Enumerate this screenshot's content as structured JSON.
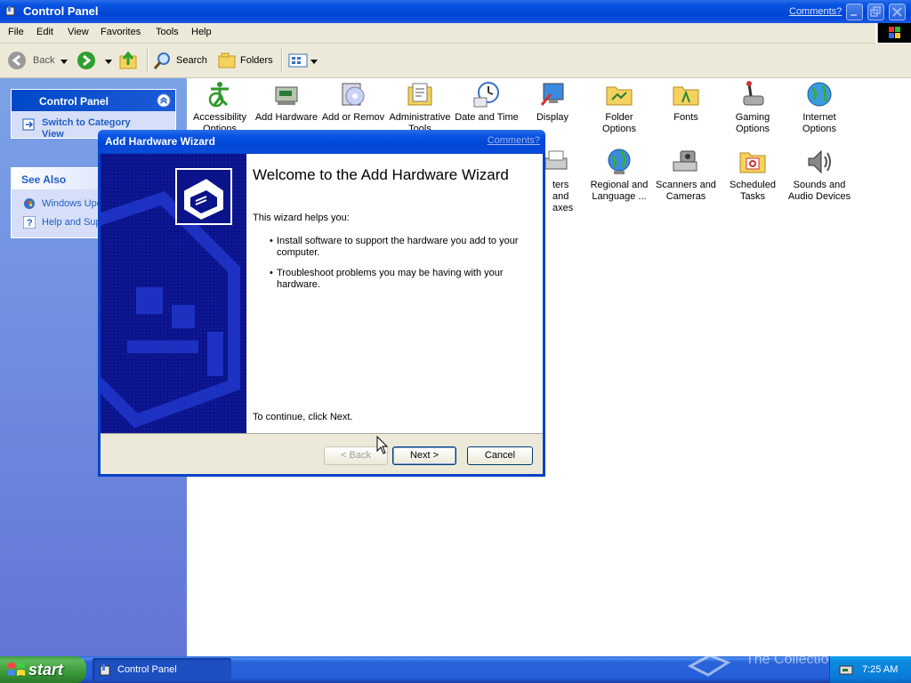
{
  "window": {
    "title": "Control Panel",
    "comments_link": "Comments?"
  },
  "menu": [
    "File",
    "Edit",
    "View",
    "Favorites",
    "Tools",
    "Help"
  ],
  "toolbar": {
    "back_label": "Back",
    "search_label": "Search",
    "folders_label": "Folders"
  },
  "left_pane": {
    "control_panel_header": "Control Panel",
    "switch_view": "Switch to Category View",
    "see_also_header": "See Also",
    "see_also_items": [
      "Windows Upd",
      "Help and Sup"
    ]
  },
  "icons_row1": [
    {
      "label": "Accessibility Options",
      "icon": "accessibility-icon"
    },
    {
      "label": "Add Hardware",
      "icon": "add-hardware-icon"
    },
    {
      "label": "Add or Remov",
      "icon": "add-remove-programs-icon"
    },
    {
      "label": "Administrative Tools",
      "icon": "administrative-tools-icon"
    },
    {
      "label": "Date and Time",
      "icon": "date-time-icon"
    },
    {
      "label": "Display",
      "icon": "display-icon"
    },
    {
      "label": "Folder Options",
      "icon": "folder-options-icon"
    },
    {
      "label": "Fonts",
      "icon": "fonts-icon"
    },
    {
      "label": "Gaming Options",
      "icon": "gaming-options-icon"
    },
    {
      "label": "Internet Options",
      "icon": "internet-options-icon"
    }
  ],
  "icons_row2": [
    {
      "label": "ters and axes",
      "icon": "printers-faxes-icon"
    },
    {
      "label": "Regional and Language ...",
      "icon": "regional-language-icon"
    },
    {
      "label": "Scanners and Cameras",
      "icon": "scanners-cameras-icon"
    },
    {
      "label": "Scheduled Tasks",
      "icon": "scheduled-tasks-icon"
    },
    {
      "label": "Sounds and Audio Devices",
      "icon": "sounds-audio-icon"
    }
  ],
  "wizard": {
    "title": "Add Hardware Wizard",
    "comments_link": "Comments?",
    "heading": "Welcome to the Add Hardware Wizard",
    "intro": "This wizard helps you:",
    "bullets": [
      "Install software to support the hardware you add to your computer.",
      "Troubleshoot problems you may be having with your hardware."
    ],
    "continue_text": "To continue, click Next.",
    "back_button": "< Back",
    "next_button": "Next >",
    "cancel_button": "Cancel"
  },
  "taskbar": {
    "start_label": "start",
    "task_item": "Control Panel",
    "clock": "7:25 AM",
    "watermark": "The Collection Book"
  },
  "colors": {
    "xp_blue": "#0046d5",
    "pane_blue": "#6375d6",
    "wizard_sidebar": "#0b138a",
    "start_green": "#3a9a3a"
  }
}
